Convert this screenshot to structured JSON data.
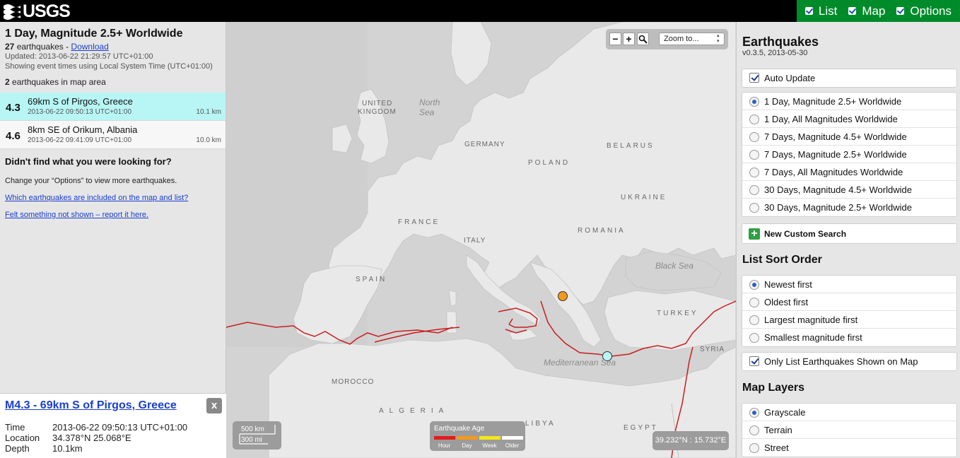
{
  "header": {
    "logo_text": "USGS",
    "tabs": [
      {
        "label": "List",
        "checked": true
      },
      {
        "label": "Map",
        "checked": true
      },
      {
        "label": "Options",
        "checked": true
      }
    ]
  },
  "list": {
    "feed_title": "1 Day, Magnitude 2.5+ Worldwide",
    "count_number": "27",
    "count_suffix": " earthquakes - ",
    "download_label": "Download",
    "updated": "Updated: 2013-06-22 21:29:57 UTC+01:00",
    "time_note": "Showing event times using Local System Time (UTC+01:00)",
    "in_area_number": "2",
    "in_area_suffix": " earthquakes in map area",
    "earthquakes": [
      {
        "mag": "4.3",
        "place": "69km S of Pirgos, Greece",
        "time": "2013-06-22 09:50:13 UTC+01:00",
        "depth": "10.1 km",
        "selected": true
      },
      {
        "mag": "4.6",
        "place": "8km SE of Orikum, Albania",
        "time": "2013-06-22 09:41:09 UTC+01:00",
        "depth": "10.0 km",
        "selected": false
      }
    ],
    "not_found_heading": "Didn't find what you were looking for?",
    "not_found_text": "Change your “Options” to view more earthquakes.",
    "link_included": "Which earthquakes are included on the map and list?",
    "link_felt": "Felt something not shown – report it here."
  },
  "detail": {
    "title": "M4.3 - 69km S of Pirgos, Greece",
    "close_label": "x",
    "time_label": "Time",
    "time_value": "2013-06-22 09:50:13 UTC+01:00",
    "location_label": "Location",
    "location_value": "34.378°N 25.068°E",
    "depth_label": "Depth",
    "depth_value": "10.1km"
  },
  "map": {
    "zoom_minus": "−",
    "zoom_plus": "+",
    "zoom_select": "Zoom to...",
    "labels": {
      "uk": "UNITED",
      "uk2": "KINGDOM",
      "north_sea": "North",
      "north_sea2": "Sea",
      "germany": "GERMANY",
      "poland": "POLAND",
      "belarus": "BELARUS",
      "ukraine": "UKRAINE",
      "france": "FRANCE",
      "romania": "ROMANIA",
      "italy": "ITALY",
      "spain": "SPAIN",
      "black_sea": "Black Sea",
      "turkey": "TURKEY",
      "syria": "SYRIA",
      "med_sea": "Mediterranean Sea",
      "morocco": "MOROCCO",
      "algeria": "ALGERIA",
      "libya": "LIBYA",
      "egypt": "EGYPT"
    },
    "scale_km": "500 km",
    "scale_mi": "300 mi",
    "legend_title": "Earthquake Age",
    "legend_items": [
      {
        "label": "Hour",
        "color": "#e51c1c"
      },
      {
        "label": "Day",
        "color": "#f39a1b"
      },
      {
        "label": "Week",
        "color": "#f5e61a"
      },
      {
        "label": "Older",
        "color": "#ffffff"
      }
    ],
    "coords": "39.232°N : 15.732°E",
    "markers": [
      {
        "name": "orikum",
        "color": "#f39a1b"
      },
      {
        "name": "pirgos",
        "color": "#b8f5f5"
      }
    ]
  },
  "options": {
    "title": "Earthquakes",
    "version": "v0.3.5, 2013-05-30",
    "auto_update": "Auto Update",
    "feeds": [
      {
        "label": "1 Day, Magnitude 2.5+ Worldwide",
        "selected": true
      },
      {
        "label": "1 Day, All Magnitudes Worldwide",
        "selected": false
      },
      {
        "label": "7 Days, Magnitude 4.5+ Worldwide",
        "selected": false
      },
      {
        "label": "7 Days, Magnitude 2.5+ Worldwide",
        "selected": false
      },
      {
        "label": "7 Days, All Magnitudes Worldwide",
        "selected": false
      },
      {
        "label": "30 Days, Magnitude 4.5+ Worldwide",
        "selected": false
      },
      {
        "label": "30 Days, Magnitude 2.5+ Worldwide",
        "selected": false
      }
    ],
    "new_search": "New Custom Search",
    "sort_heading": "List Sort Order",
    "sort": [
      {
        "label": "Newest first",
        "selected": true
      },
      {
        "label": "Oldest first",
        "selected": false
      },
      {
        "label": "Largest magnitude first",
        "selected": false
      },
      {
        "label": "Smallest magnitude first",
        "selected": false
      }
    ],
    "only_list": "Only List Earthquakes Shown on Map",
    "layers_heading": "Map Layers",
    "layers": [
      {
        "label": "Grayscale",
        "selected": true
      },
      {
        "label": "Terrain",
        "selected": false
      },
      {
        "label": "Street",
        "selected": false
      }
    ]
  }
}
